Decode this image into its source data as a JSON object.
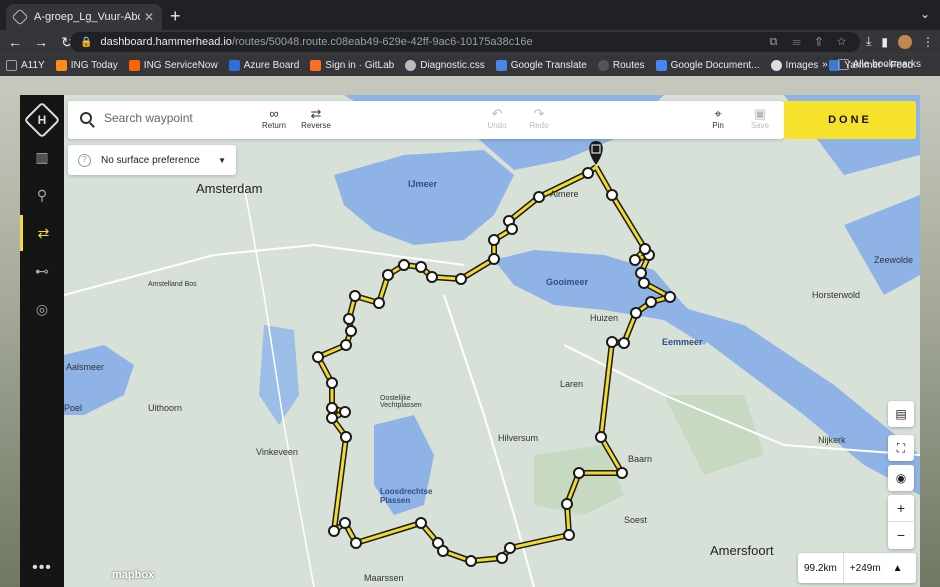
{
  "browser": {
    "tab_title": "A-groep_Lg_Vuur-Abcoude",
    "url_host": "dashboard.hammerhead.io",
    "url_path": "/routes/50048.route.c08eab49-629e-42ff-9ac6-10175a38c16e",
    "bookmarks": [
      "A11Y",
      "ING Today",
      "ING ServiceNow",
      "Azure Board",
      "Sign in · GitLab",
      "Diagnostic.css",
      "Google Translate",
      "Routes",
      "Google Document...",
      "Images",
      "Yammer - Feed"
    ],
    "bookmark_colors": [
      "#9aa0a6",
      "#ff8c1a",
      "#ff6200",
      "#2d6fd9",
      "#fc6d26",
      "#bbbbbb",
      "#4a86e8",
      "#555555",
      "#4285f4",
      "#dddddd",
      "#3b7bd6"
    ],
    "bookmarks_more": "»",
    "all_bookmarks": "Alle bookmarks"
  },
  "toolbar": {
    "search_placeholder": "Search waypoint",
    "return_label": "Return",
    "reverse_label": "Reverse",
    "undo_label": "Undo",
    "redo_label": "Redo",
    "pin_label": "Pin",
    "save_label": "Save",
    "done_label": "DONE"
  },
  "surface": {
    "label": "No surface preference"
  },
  "map": {
    "places": [
      {
        "name": "Amsterdam",
        "kind": "big"
      },
      {
        "name": "IJmeer",
        "kind": "water"
      },
      {
        "name": "Almere",
        "kind": "city"
      },
      {
        "name": "Gooimeer",
        "kind": "water"
      },
      {
        "name": "Eemmeer",
        "kind": "water"
      },
      {
        "name": "Huizen",
        "kind": "city"
      },
      {
        "name": "Laren",
        "kind": "city"
      },
      {
        "name": "Hilversum",
        "kind": "city"
      },
      {
        "name": "Baarn",
        "kind": "city"
      },
      {
        "name": "Soest",
        "kind": "city"
      },
      {
        "name": "Amersfoort",
        "kind": "big"
      },
      {
        "name": "Nijkerk",
        "kind": "city"
      },
      {
        "name": "Zeewolde",
        "kind": "city"
      },
      {
        "name": "Horsterwold",
        "kind": "city"
      },
      {
        "name": "Loosdrechtse Plassen",
        "kind": "water"
      },
      {
        "name": "Oostelijke Vechtplassen",
        "kind": "city"
      },
      {
        "name": "Vinkeveen",
        "kind": "city"
      },
      {
        "name": "Uithoorn",
        "kind": "city"
      },
      {
        "name": "Aalsmeer",
        "kind": "city"
      },
      {
        "name": "Amstelland Bos",
        "kind": "city"
      },
      {
        "name": "Maarssen",
        "kind": "city"
      },
      {
        "name": "Poel",
        "kind": "city"
      }
    ],
    "route_color": "#f3d92b",
    "attribution": "mapbox"
  },
  "stats": {
    "distance": "99.2km",
    "elevation": "+249m"
  }
}
